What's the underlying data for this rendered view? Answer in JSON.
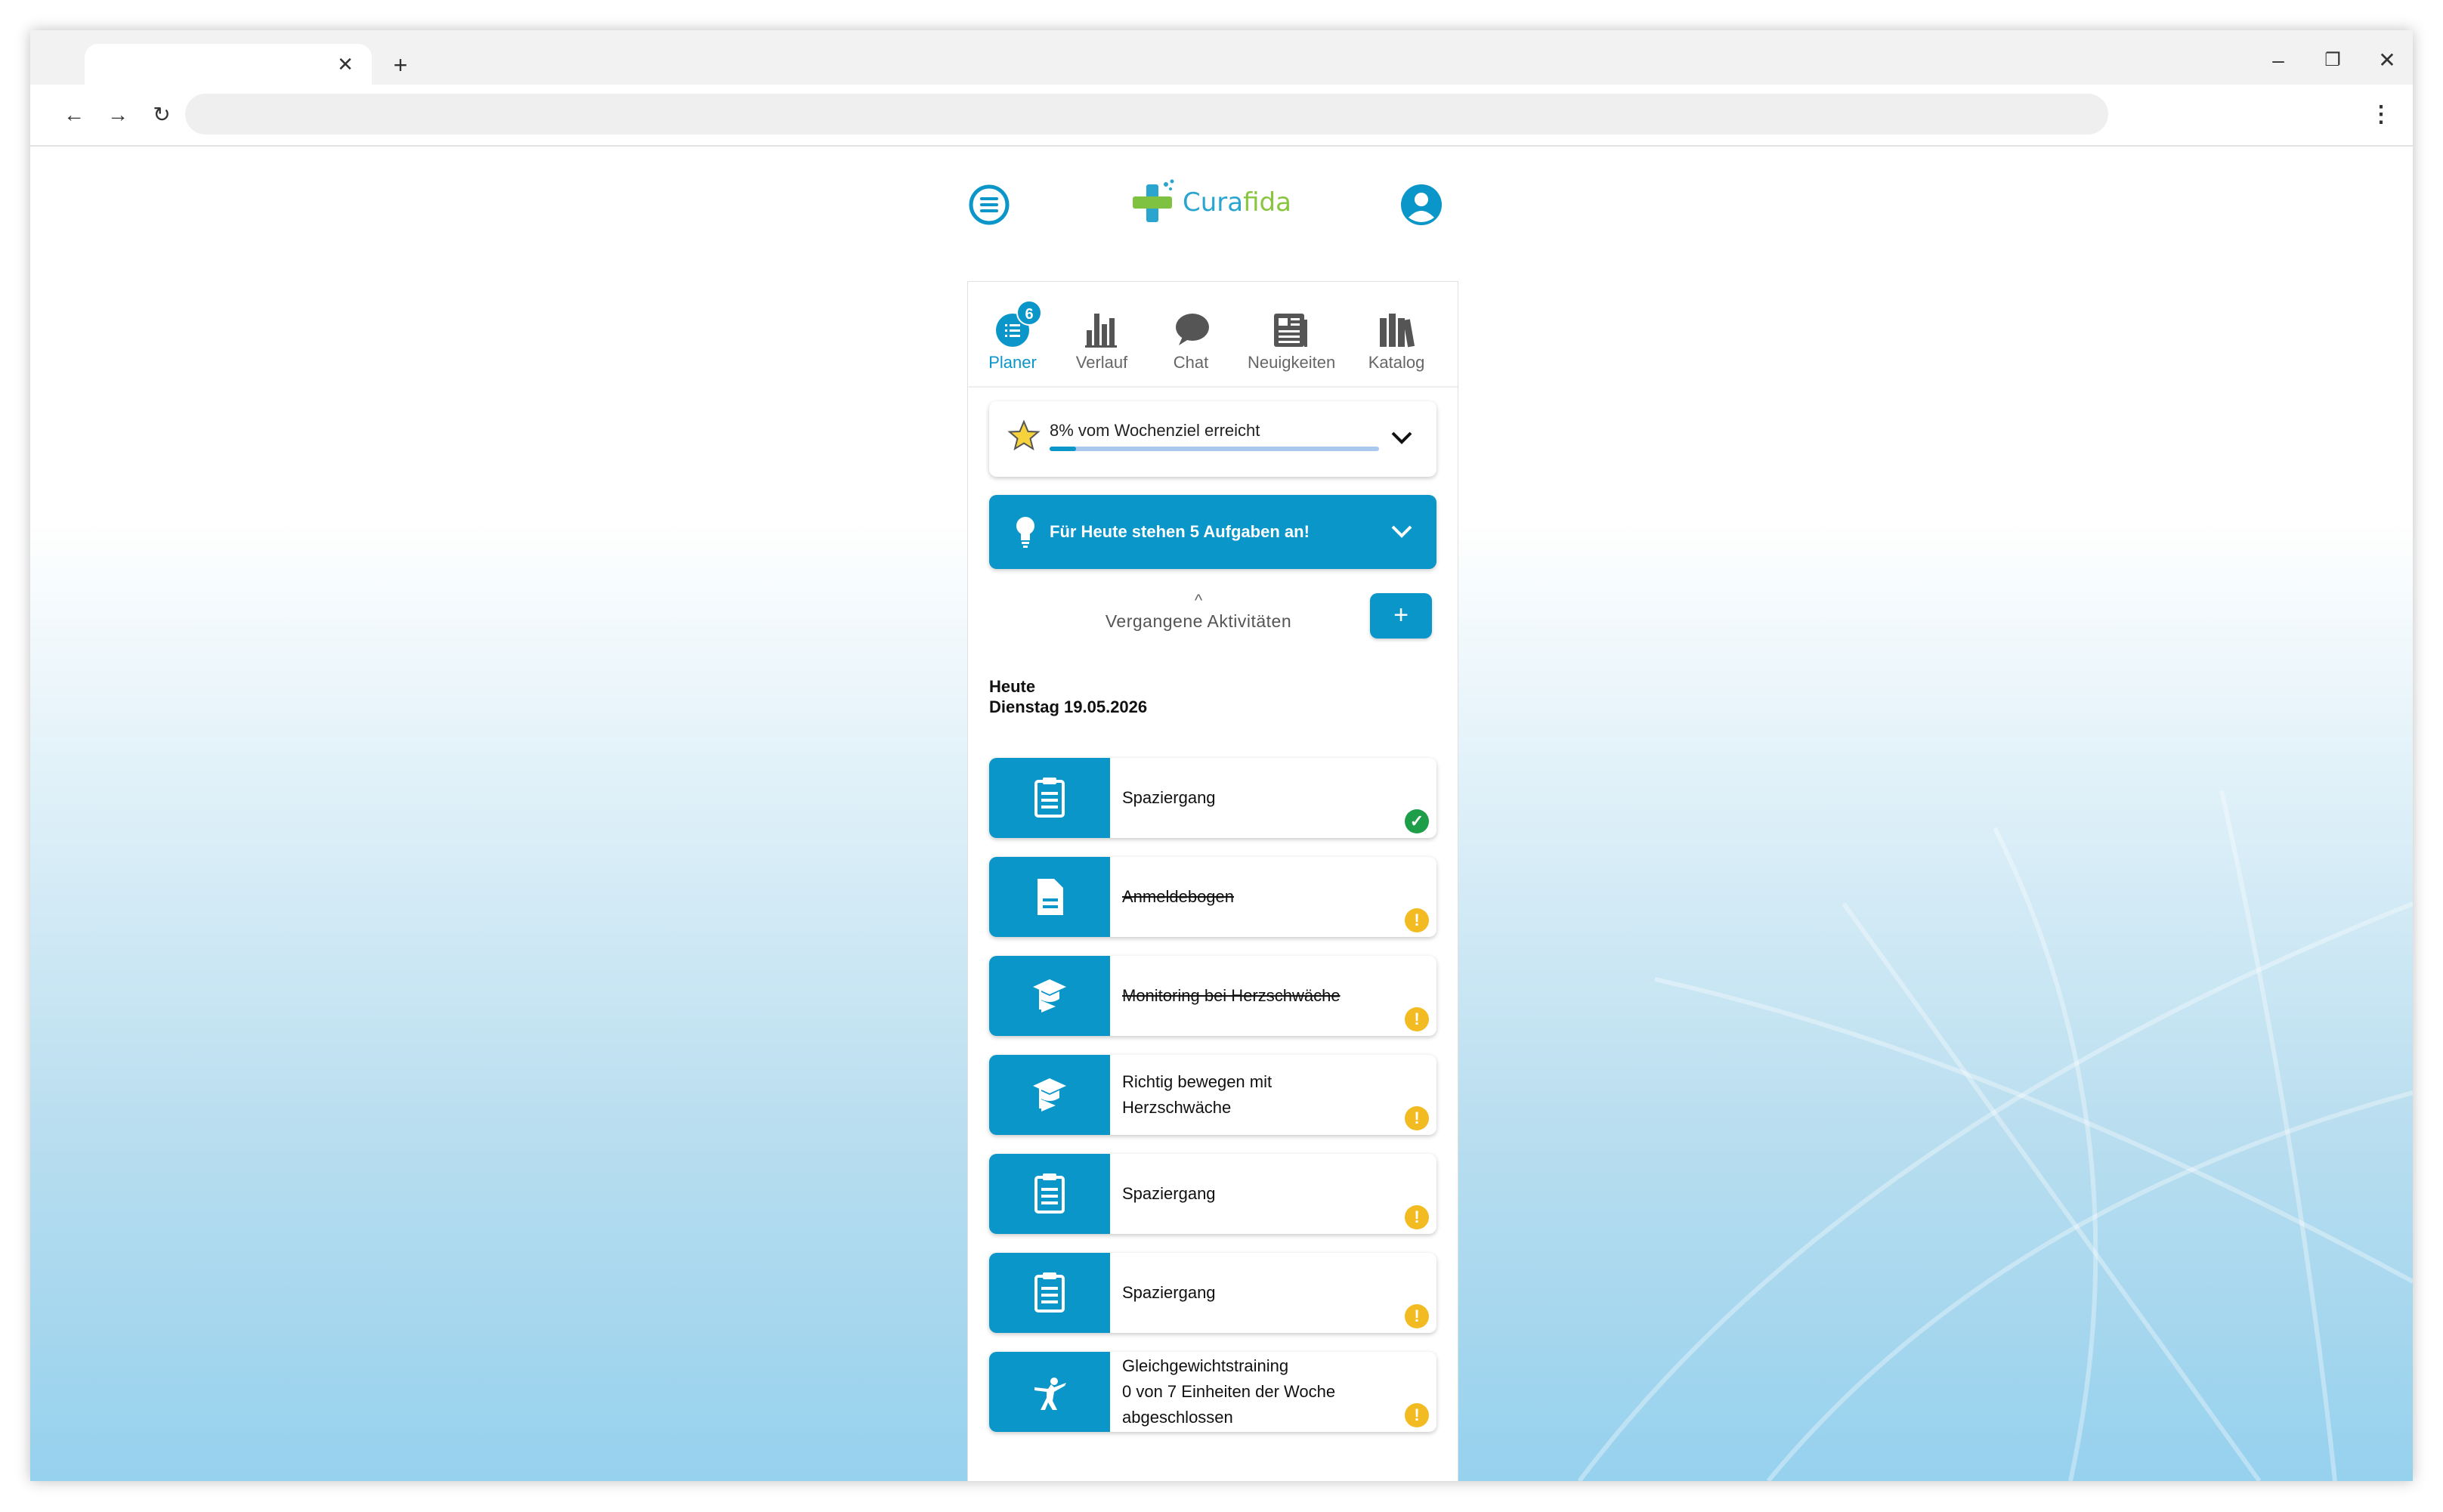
{
  "browser": {
    "tab_title": "",
    "tab_close": "✕",
    "new_tab": "+",
    "minimize": "–",
    "restore": "❐",
    "close": "✕",
    "back": "←",
    "forward": "→",
    "reload": "↻",
    "address": "",
    "menu": "⋮"
  },
  "app": {
    "logo": {
      "part1": "Cura",
      "part2": "fida"
    },
    "nav": [
      {
        "label": "Planer",
        "icon": "list-icon",
        "badge": "6",
        "active": true
      },
      {
        "label": "Verlauf",
        "icon": "bar-chart-icon"
      },
      {
        "label": "Chat",
        "icon": "chat-icon"
      },
      {
        "label": "Neuigkeiten",
        "icon": "newspaper-icon"
      },
      {
        "label": "Katalog",
        "icon": "books-icon"
      }
    ],
    "goal": {
      "text": "8% vom Wochenziel erreicht",
      "progress_percent": 8
    },
    "tasks_banner": "Für Heute stehen 5 Aufgaben an!",
    "past_activities": {
      "caret": "^",
      "label": "Vergangene Aktivitäten"
    },
    "add_button": "+",
    "day": {
      "label": "Heute",
      "date": "Dienstag 19.05.2026"
    },
    "activities": [
      {
        "title": "Spaziergang",
        "icon": "clipboard-icon",
        "status": "done",
        "strike": false
      },
      {
        "title": "Anmeldebogen",
        "icon": "document-icon",
        "status": "warn",
        "strike": true
      },
      {
        "title": "Monitoring bei Herzschwäche",
        "icon": "education-icon",
        "status": "warn",
        "strike": true
      },
      {
        "title": "Richtig bewegen mit",
        "title2": "Herzschwäche",
        "icon": "education-icon",
        "status": "warn",
        "strike": false
      },
      {
        "title": "Spaziergang",
        "icon": "clipboard-icon",
        "status": "warn",
        "strike": false
      },
      {
        "title": "Spaziergang",
        "icon": "clipboard-icon",
        "status": "warn",
        "strike": false
      },
      {
        "title": "Gleichgewichtstraining",
        "title2": "0 von 7 Einheiten der Woche",
        "title3": "abgeschlossen",
        "icon": "balance-icon",
        "status": "warn",
        "strike": false
      }
    ],
    "status_symbols": {
      "done": "✓",
      "warn": "!"
    }
  },
  "colors": {
    "accent": "#0a96c8",
    "done": "#1e9e48",
    "warn": "#f3bb22",
    "logo_blue": "#2aa5cf",
    "logo_green": "#8ac540"
  }
}
